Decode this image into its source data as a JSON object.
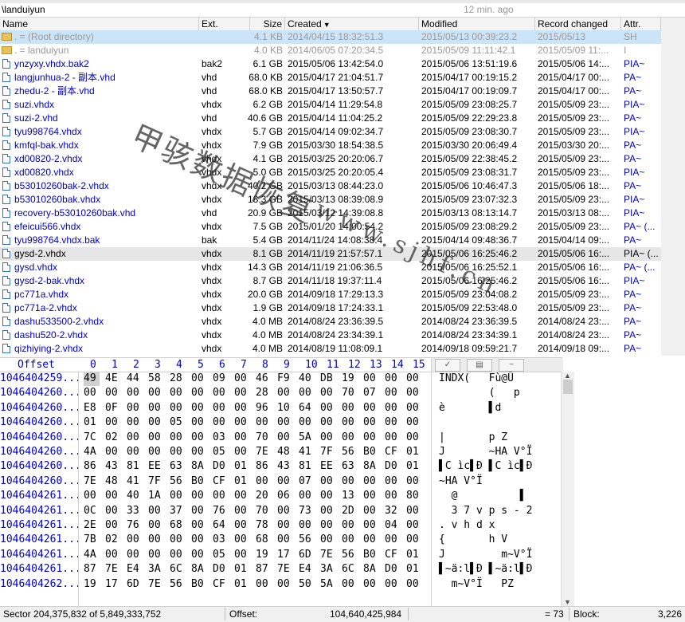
{
  "path": "\\landuiyun",
  "time_ago": "12 min. ago",
  "columns": {
    "name": "Name",
    "ext": "Ext.",
    "size": "Size",
    "created": "Created",
    "modified": "Modified",
    "record": "Record changed",
    "attr": "Attr."
  },
  "files": [
    {
      "name": ". = (Root directory)",
      "ext": "",
      "size": "4.1 KB",
      "created": "2014/04/15   18:32:51.3",
      "modified": "2015/05/13   00:39:23.2",
      "record": "2015/05/13",
      "attr": "SH"
    },
    {
      "name": ". = landuiyun",
      "ext": "",
      "size": "4.0 KB",
      "created": "2014/06/05   07:20:34.5",
      "modified": "2015/05/09   11:11:42.1",
      "record": "2015/05/09   11:...",
      "attr": "I"
    },
    {
      "name": "ynzyxy.vhdx.bak2",
      "ext": "bak2",
      "size": "6.1 GB",
      "created": "2015/05/06   13:42:54.0",
      "modified": "2015/05/06   13:51:19.6",
      "record": "2015/05/06   14:...",
      "attr": "PIA~"
    },
    {
      "name": "langjunhua-2 - 副本.vhd",
      "ext": "vhd",
      "size": "68.0 KB",
      "created": "2015/04/17   21:04:51.7",
      "modified": "2015/04/17   00:19:15.2",
      "record": "2015/04/17   00:...",
      "attr": "PA~"
    },
    {
      "name": "zhedu-2 - 副本.vhd",
      "ext": "vhd",
      "size": "68.0 KB",
      "created": "2015/04/17   13:50:57.7",
      "modified": "2015/04/17   00:19:09.7",
      "record": "2015/04/17   00:...",
      "attr": "PA~"
    },
    {
      "name": "suzi.vhdx",
      "ext": "vhdx",
      "size": "6.2 GB",
      "created": "2015/04/14   11:29:54.8",
      "modified": "2015/05/09   23:08:25.7",
      "record": "2015/05/09   23:...",
      "attr": "PIA~"
    },
    {
      "name": "suzi-2.vhd",
      "ext": "vhd",
      "size": "40.6 GB",
      "created": "2015/04/14   11:04:25.2",
      "modified": "2015/05/09   22:29:23.8",
      "record": "2015/05/09   23:...",
      "attr": "PA~"
    },
    {
      "name": "tyu998764.vhdx",
      "ext": "vhdx",
      "size": "5.7 GB",
      "created": "2015/04/14   09:02:34.7",
      "modified": "2015/05/09   23:08:30.7",
      "record": "2015/05/09   23:...",
      "attr": "PIA~"
    },
    {
      "name": "kmfql-bak.vhdx",
      "ext": "vhdx",
      "size": "7.9 GB",
      "created": "2015/03/30   18:54:38.5",
      "modified": "2015/03/30   20:06:49.4",
      "record": "2015/03/30   20:...",
      "attr": "PA~"
    },
    {
      "name": "xd00820-2.vhdx",
      "ext": "vhdx",
      "size": "4.1 GB",
      "created": "2015/03/25   20:20:06.7",
      "modified": "2015/05/09   22:38:45.2",
      "record": "2015/05/09   23:...",
      "attr": "PA~"
    },
    {
      "name": "xd00820.vhdx",
      "ext": "vhdx",
      "size": "5.0 GB",
      "created": "2015/03/25   20:20:05.4",
      "modified": "2015/05/09   23:08:31.7",
      "record": "2015/05/09   23:...",
      "attr": "PIA~"
    },
    {
      "name": "b53010260bak-2.vhdx",
      "ext": "vhdx",
      "size": "40.2 GB",
      "created": "2015/03/13   08:44:23.0",
      "modified": "2015/05/06   10:46:47.3",
      "record": "2015/05/06   18:...",
      "attr": "PA~"
    },
    {
      "name": "b53010260bak.vhdx",
      "ext": "vhdx",
      "size": "18.3 GB",
      "created": "2015/03/13   08:39:08.9",
      "modified": "2015/05/09   23:07:32.3",
      "record": "2015/05/09   23:...",
      "attr": "PIA~"
    },
    {
      "name": "recovery-b53010260bak.vhd",
      "ext": "vhd",
      "size": "20.9 GB",
      "created": "2015/03/12   14:39:08.8",
      "modified": "2015/03/13   08:13:14.7",
      "record": "2015/03/13   08:...",
      "attr": "PIA~"
    },
    {
      "name": "efeicui566.vhdx",
      "ext": "vhdx",
      "size": "7.5 GB",
      "created": "2015/01/20   14:00:54.2",
      "modified": "2015/05/09   23:08:29.2",
      "record": "2015/05/09   23:...",
      "attr": "PA~ (..."
    },
    {
      "name": "tyu998764.vhdx.bak",
      "ext": "bak",
      "size": "5.4 GB",
      "created": "2014/11/24   14:08:38.4",
      "modified": "2015/04/14   09:48:36.7",
      "record": "2015/04/14   09:...",
      "attr": "PA~"
    },
    {
      "name": "gysd-2.vhdx",
      "ext": "vhdx",
      "size": "8.1 GB",
      "created": "2014/11/19   21:57:57.1",
      "modified": "2015/05/06   16:25:46.2",
      "record": "2015/05/06   16:...",
      "attr": "PIA~ (..."
    },
    {
      "name": "gysd.vhdx",
      "ext": "vhdx",
      "size": "14.3 GB",
      "created": "2014/11/19   21:06:36.5",
      "modified": "2015/05/06   16:25:52.1",
      "record": "2015/05/06   16:...",
      "attr": "PA~ (..."
    },
    {
      "name": "gysd-2-bak.vhdx",
      "ext": "vhdx",
      "size": "8.7 GB",
      "created": "2014/11/18   19:37:11.4",
      "modified": "2015/05/06   16:25:46.2",
      "record": "2015/05/06   16:...",
      "attr": "PIA~"
    },
    {
      "name": "pc771a.vhdx",
      "ext": "vhdx",
      "size": "20.0 GB",
      "created": "2014/09/18   17:29:13.3",
      "modified": "2015/05/09   23:04:08.2",
      "record": "2015/05/09   23:...",
      "attr": "PA~"
    },
    {
      "name": "pc771a-2.vhdx",
      "ext": "vhdx",
      "size": "1.9 GB",
      "created": "2014/09/18   17:24:33.1",
      "modified": "2015/05/09   22:53:48.0",
      "record": "2015/05/09   23:...",
      "attr": "PA~"
    },
    {
      "name": "dashu533500-2.vhdx",
      "ext": "vhdx",
      "size": "4.0 MB",
      "created": "2014/08/24   23:36:39.5",
      "modified": "2014/08/24   23:36:39.5",
      "record": "2014/08/24   23:...",
      "attr": "PA~"
    },
    {
      "name": "dashu520-2.vhdx",
      "ext": "vhdx",
      "size": "4.0 MB",
      "created": "2014/08/24   23:34:39.1",
      "modified": "2014/08/24   23:34:39.1",
      "record": "2014/08/24   23:...",
      "attr": "PA~"
    },
    {
      "name": "qizhiying-2.vhdx",
      "ext": "vhdx",
      "size": "4.0 MB",
      "created": "2014/08/19   11:08:09.1",
      "modified": "2014/09/18   09:59:21.7",
      "record": "2014/09/18   09:...",
      "attr": "PA~"
    }
  ],
  "watermark_text": "甲骇数据恢复",
  "watermark_url": "www.sjhf.cn",
  "hex": {
    "offset_label": "Offset",
    "col_headers": [
      "0",
      "1",
      "2",
      "3",
      "4",
      "5",
      "6",
      "7",
      "8",
      "9",
      "10",
      "11",
      "12",
      "13",
      "14",
      "15"
    ],
    "rows": [
      {
        "off": "1046404259...",
        "bytes": [
          "49",
          "4E",
          "44",
          "58",
          "28",
          "00",
          "09",
          "00",
          "46",
          "F9",
          "40",
          "DB",
          "19",
          "00",
          "00",
          "00"
        ],
        "ascii": "INDX(   Fù@Û"
      },
      {
        "off": "1046404260...",
        "bytes": [
          "00",
          "00",
          "00",
          "00",
          "00",
          "00",
          "00",
          "00",
          "28",
          "00",
          "00",
          "00",
          "70",
          "07",
          "00",
          "00"
        ],
        "ascii": "        (   p"
      },
      {
        "off": "1046404260...",
        "bytes": [
          "E8",
          "0F",
          "00",
          "00",
          "00",
          "00",
          "00",
          "00",
          "96",
          "10",
          "64",
          "00",
          "00",
          "00",
          "00",
          "00"
        ],
        "ascii": "è       ▌d"
      },
      {
        "off": "1046404260...",
        "bytes": [
          "01",
          "00",
          "00",
          "00",
          "05",
          "00",
          "00",
          "00",
          "00",
          "00",
          "00",
          "00",
          "00",
          "00",
          "00",
          "00"
        ],
        "ascii": ""
      },
      {
        "off": "1046404260...",
        "bytes": [
          "7C",
          "02",
          "00",
          "00",
          "00",
          "00",
          "03",
          "00",
          "70",
          "00",
          "5A",
          "00",
          "00",
          "00",
          "00",
          "00"
        ],
        "ascii": "|       p Z"
      },
      {
        "off": "1046404260...",
        "bytes": [
          "4A",
          "00",
          "00",
          "00",
          "00",
          "00",
          "05",
          "00",
          "7E",
          "48",
          "41",
          "7F",
          "56",
          "B0",
          "CF",
          "01"
        ],
        "ascii": "J       ~HA V°Ï"
      },
      {
        "off": "1046404260...",
        "bytes": [
          "86",
          "43",
          "81",
          "EE",
          "63",
          "8A",
          "D0",
          "01",
          "86",
          "43",
          "81",
          "EE",
          "63",
          "8A",
          "D0",
          "01"
        ],
        "ascii": "▌C ìc▌Ð ▌C ìc▌Ð"
      },
      {
        "off": "1046404260...",
        "bytes": [
          "7E",
          "48",
          "41",
          "7F",
          "56",
          "B0",
          "CF",
          "01",
          "00",
          "00",
          "07",
          "00",
          "00",
          "00",
          "00",
          "00"
        ],
        "ascii": "~HA V°Ï"
      },
      {
        "off": "1046404261...",
        "bytes": [
          "00",
          "00",
          "40",
          "1A",
          "00",
          "00",
          "00",
          "00",
          "20",
          "06",
          "00",
          "00",
          "13",
          "00",
          "00",
          "80"
        ],
        "ascii": "  @          ▌"
      },
      {
        "off": "1046404261...",
        "bytes": [
          "0C",
          "00",
          "33",
          "00",
          "37",
          "00",
          "76",
          "00",
          "70",
          "00",
          "73",
          "00",
          "2D",
          "00",
          "32",
          "00"
        ],
        "ascii": "  3 7 v p s - 2"
      },
      {
        "off": "1046404261...",
        "bytes": [
          "2E",
          "00",
          "76",
          "00",
          "68",
          "00",
          "64",
          "00",
          "78",
          "00",
          "00",
          "00",
          "00",
          "00",
          "04",
          "00"
        ],
        "ascii": ". v h d x"
      },
      {
        "off": "1046404261...",
        "bytes": [
          "7B",
          "02",
          "00",
          "00",
          "00",
          "00",
          "03",
          "00",
          "68",
          "00",
          "56",
          "00",
          "00",
          "00",
          "00",
          "00"
        ],
        "ascii": "{       h V"
      },
      {
        "off": "1046404261...",
        "bytes": [
          "4A",
          "00",
          "00",
          "00",
          "00",
          "00",
          "05",
          "00",
          "19",
          "17",
          "6D",
          "7E",
          "56",
          "B0",
          "CF",
          "01"
        ],
        "ascii": "J         m~V°Ï"
      },
      {
        "off": "1046404261...",
        "bytes": [
          "87",
          "7E",
          "E4",
          "3A",
          "6C",
          "8A",
          "D0",
          "01",
          "87",
          "7E",
          "E4",
          "3A",
          "6C",
          "8A",
          "D0",
          "01"
        ],
        "ascii": "▌~ä:l▌Ð ▌~ä:l▌Ð"
      },
      {
        "off": "1046404262...",
        "bytes": [
          "19",
          "17",
          "6D",
          "7E",
          "56",
          "B0",
          "CF",
          "01",
          "00",
          "00",
          "50",
          "5A",
          "00",
          "00",
          "00",
          "00"
        ],
        "ascii": "  m~V°Ï   PZ"
      }
    ]
  },
  "status": {
    "sector": "Sector 204,375,832 of 5,849,333,752",
    "offset_label": "Offset:",
    "offset_value": "104,640,425,984",
    "eq": "= 73",
    "block_label": "Block:",
    "block_value": "3,226"
  }
}
